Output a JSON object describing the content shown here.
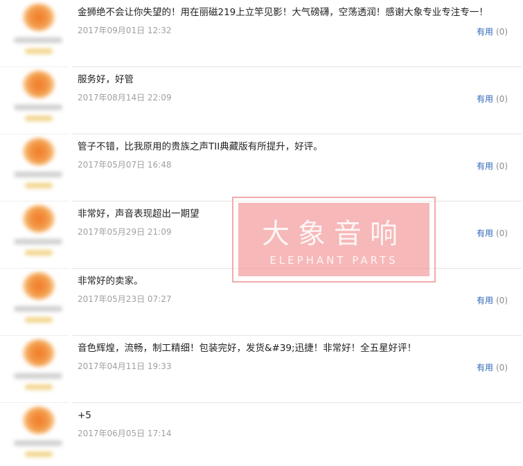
{
  "reviews": [
    {
      "text": "金狮绝不会让你失望的！用在丽磁219上立竿见影！大气磅礴，空荡透润！感谢大象专业专注专一！",
      "date": "2017年09月01日 12:32",
      "useful_label": "有用",
      "useful_count": "(0)"
    },
    {
      "text": "服务好，好管",
      "date": "2017年08月14日 22:09",
      "useful_label": "有用",
      "useful_count": "(0)"
    },
    {
      "text": "管子不错，比我原用的贵族之声TII典藏版有所提升，好评。",
      "date": "2017年05月07日 16:48",
      "useful_label": "有用",
      "useful_count": "(0)"
    },
    {
      "text": "非常好，声音表现超出一期望",
      "date": "2017年05月29日 21:09",
      "useful_label": "有用",
      "useful_count": "(0)"
    },
    {
      "text": "非常好的卖家。",
      "date": "2017年05月23日 07:27",
      "useful_label": "有用",
      "useful_count": "(0)"
    },
    {
      "text": "音色辉煌，流畅，制工精细！包装完好，发货&#39;迅捷！非常好！全五星好评！",
      "date": "2017年04月11日 19:33",
      "useful_label": "有用",
      "useful_count": "(0)"
    },
    {
      "text": "+5",
      "date": "2017年06月05日 17:14",
      "useful_label": "",
      "useful_count": ""
    }
  ],
  "watermark": {
    "title": "大象音响",
    "subtitle": "ELEPHANT PARTS"
  },
  "colors": {
    "link": "#2c66b8",
    "date": "#a0a0a0",
    "watermark": "#ee7d7d"
  }
}
